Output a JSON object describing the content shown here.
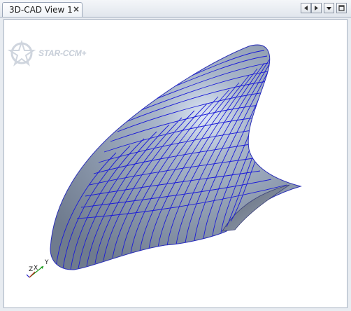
{
  "tab": {
    "title": "3D-CAD View 1",
    "close_glyph": "×"
  },
  "tab_controls": [
    {
      "icon": "scroll-left-icon"
    },
    {
      "icon": "scroll-right-icon"
    },
    {
      "icon": "tab-list-dropdown-icon"
    },
    {
      "icon": "maximize-icon"
    }
  ],
  "watermark": {
    "text": "STAR-CCM+"
  },
  "triad": {
    "x_label": "X",
    "y_label": "Y",
    "z_label": "Z"
  },
  "colors": {
    "surface": "#8f9cb0",
    "contour_lines": "#1a1ad8",
    "background": "#ffffff"
  }
}
